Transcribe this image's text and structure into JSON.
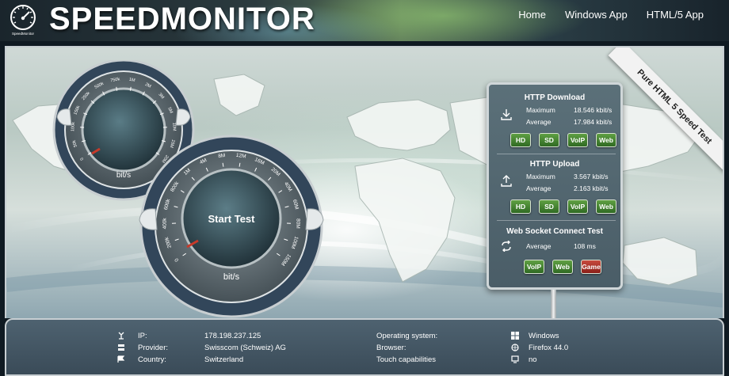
{
  "header": {
    "logo_text": "SPEEDMONITOR",
    "logo_icon_text": "SpeedMonitor",
    "nav": [
      "Home",
      "Windows App",
      "HTML/5 App"
    ]
  },
  "ribbon": "Pure HTML 5 Speed Test",
  "gauge_small": {
    "ticks": [
      "0",
      "50k",
      "100k",
      "150k",
      "250k",
      "500k",
      "750k",
      "1M",
      "2M",
      "3M",
      "5M",
      "10M",
      "15M",
      "20M"
    ],
    "unit": "bit/s"
  },
  "gauge_big": {
    "ticks": [
      "0",
      "200k",
      "400k",
      "600k",
      "800k",
      "1M",
      "4M",
      "8M",
      "12M",
      "16M",
      "20M",
      "40M",
      "60M",
      "80M",
      "100M",
      "150M"
    ],
    "unit": "bit/s",
    "start_label": "Start Test"
  },
  "download": {
    "title": "HTTP Download",
    "max_label": "Maximum",
    "max_value": "18.546 kbit/s",
    "avg_label": "Average",
    "avg_value": "17.984 kbit/s",
    "buttons": [
      "HD",
      "SD",
      "VoIP",
      "Web"
    ]
  },
  "upload": {
    "title": "HTTP Upload",
    "max_label": "Maximum",
    "max_value": "3.567 kbit/s",
    "avg_label": "Average",
    "avg_value": "2.163 kbit/s",
    "buttons": [
      "HD",
      "SD",
      "VoIP",
      "Web"
    ]
  },
  "websocket": {
    "title": "Web Socket Connect Test",
    "avg_label": "Average",
    "avg_value": "108 ms",
    "buttons": [
      "VoIP",
      "Web",
      "Game"
    ]
  },
  "footer": {
    "ip_label": "IP:",
    "ip_value": "178.198.237.125",
    "provider_label": "Provider:",
    "provider_value": "Swisscom (Schweiz) AG",
    "country_label": "Country:",
    "country_value": "Switzerland",
    "os_label": "Operating system:",
    "os_value": "Windows",
    "browser_label": "Browser:",
    "browser_value": "Firefox 44.0",
    "touch_label": "Touch capabilities",
    "touch_value": "no"
  },
  "colors": {
    "panel": "#4f636d",
    "button_green": "#3f7f2e",
    "button_red": "#a8322a",
    "footer": "#435663"
  }
}
